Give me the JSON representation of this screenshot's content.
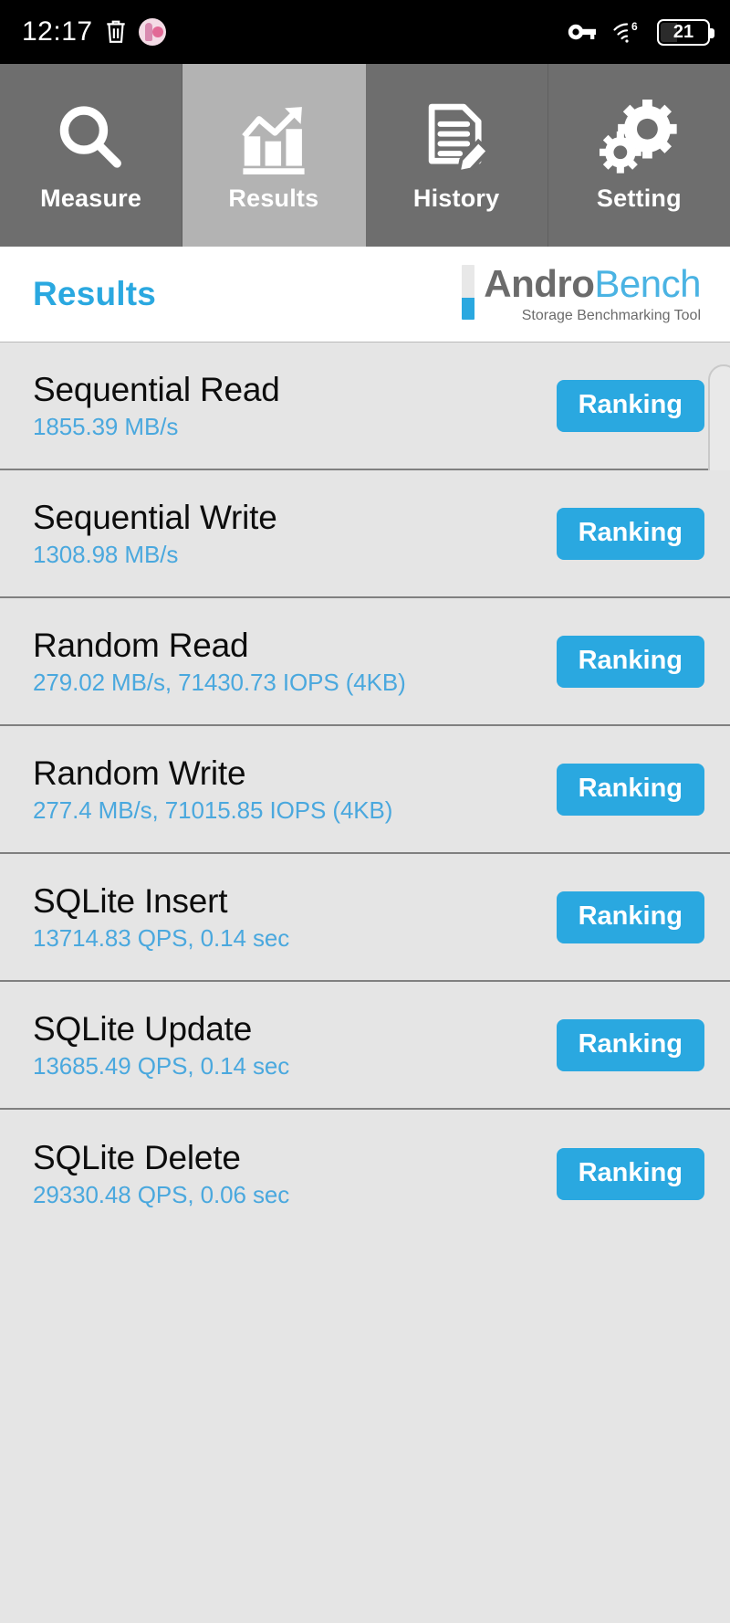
{
  "statusbar": {
    "time": "12:17",
    "icons": [
      "trash-icon",
      "app-notification-icon",
      "vpn-key-icon",
      "wifi-6-icon"
    ],
    "battery_level": "21"
  },
  "tabs": [
    {
      "id": "measure",
      "label": "Measure",
      "icon": "search-icon",
      "active": false
    },
    {
      "id": "results",
      "label": "Results",
      "icon": "bar-chart-icon",
      "active": true
    },
    {
      "id": "history",
      "label": "History",
      "icon": "document-edit-icon",
      "active": false
    },
    {
      "id": "setting",
      "label": "Setting",
      "icon": "gears-icon",
      "active": false
    }
  ],
  "header": {
    "page_title": "Results",
    "brand_primary": "Andro",
    "brand_secondary": "Bench",
    "brand_tagline": "Storage Benchmarking Tool"
  },
  "results": [
    {
      "name": "Sequential Read",
      "value": "1855.39 MB/s",
      "button": "Ranking"
    },
    {
      "name": "Sequential Write",
      "value": "1308.98 MB/s",
      "button": "Ranking"
    },
    {
      "name": "Random Read",
      "value": "279.02 MB/s, 71430.73 IOPS (4KB)",
      "button": "Ranking"
    },
    {
      "name": "Random Write",
      "value": "277.4 MB/s, 71015.85 IOPS (4KB)",
      "button": "Ranking"
    },
    {
      "name": "SQLite Insert",
      "value": "13714.83 QPS, 0.14 sec",
      "button": "Ranking"
    },
    {
      "name": "SQLite Update",
      "value": "13685.49 QPS, 0.14 sec",
      "button": "Ranking"
    },
    {
      "name": "SQLite Delete",
      "value": "29330.48 QPS, 0.06 sec",
      "button": "Ranking"
    }
  ],
  "colors": {
    "accent_blue": "#2aa8e0",
    "value_blue": "#4aa8de",
    "tab_inactive": "#6e6e6e",
    "tab_active": "#b3b3b3",
    "row_bg": "#e5e5e5",
    "divider": "#808080",
    "statusbar_bg": "#000000"
  }
}
